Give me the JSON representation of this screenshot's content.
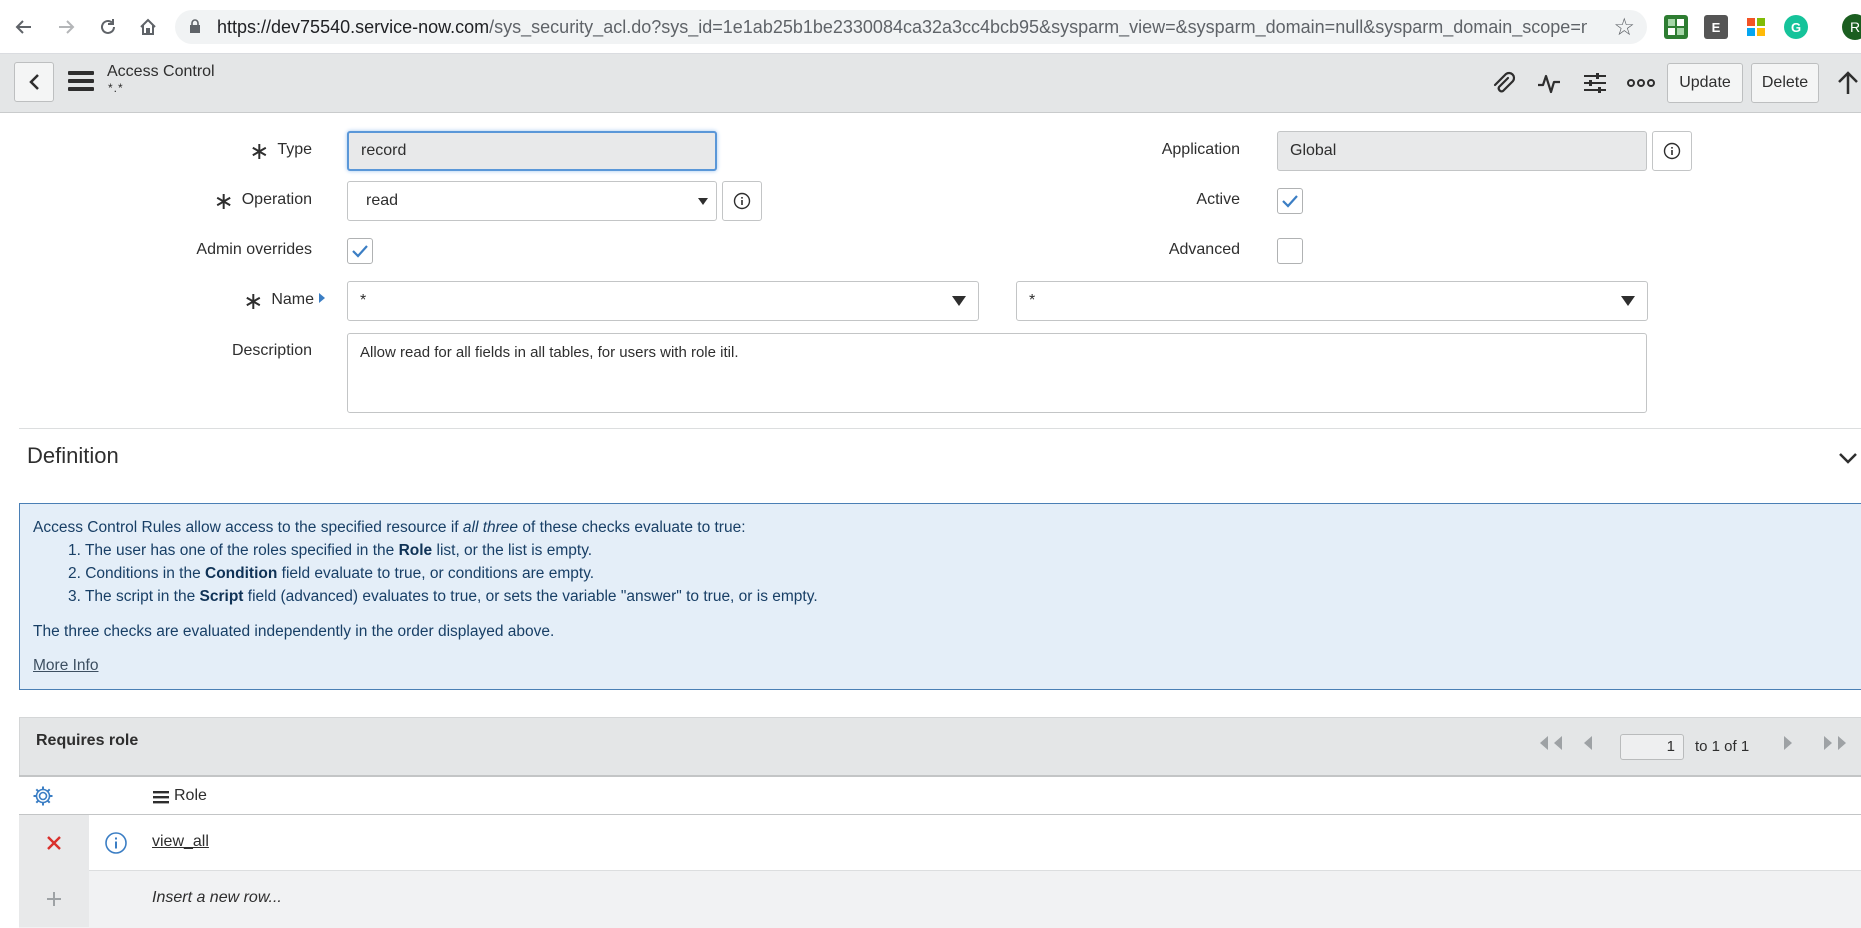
{
  "browser": {
    "url_main": "https://dev75540.service-now.com",
    "url_rest": "/sys_security_acl.do?sys_id=1e1ab25b1be2330084ca32a3cc4bcb95&sysparm_view=&sysparm_domain=null&sysparm_domain_scope=null&sys...",
    "extension_e": "E",
    "extension_g": "G",
    "profile_initial": "R"
  },
  "header": {
    "title": "Access Control",
    "subtitle": "*.*",
    "update_label": "Update",
    "delete_label": "Delete"
  },
  "form": {
    "type_label": "Type",
    "type_value": "record",
    "operation_label": "Operation",
    "operation_value": "read",
    "admin_overrides_label": "Admin overrides",
    "admin_overrides_checked": true,
    "name_label": "Name",
    "name_table_value": "*",
    "name_field_value": "*",
    "description_label": "Description",
    "description_value": "Allow read for all fields in all tables, for users with role itil.",
    "application_label": "Application",
    "application_value": "Global",
    "active_label": "Active",
    "active_checked": true,
    "advanced_label": "Advanced",
    "advanced_checked": false
  },
  "definition": {
    "title": "Definition",
    "intro_a": "Access Control Rules allow access to the specified resource if ",
    "intro_em": "all three",
    "intro_b": " of these checks evaluate to true:",
    "item1_a": "1. The user has one of the roles specified in the ",
    "item1_b": "Role",
    "item1_c": " list, or the list is empty.",
    "item2_a": "2. Conditions in the ",
    "item2_b": "Condition",
    "item2_c": " field evaluate to true, or conditions are empty.",
    "item3_a": "3. The script in the ",
    "item3_b": "Script",
    "item3_c": " field (advanced) evaluates to true, or sets the variable \"answer\" to true, or is empty.",
    "footer": "The three checks are evaluated independently in the order displayed above.",
    "more_info": "More Info"
  },
  "related_list": {
    "title": "Requires role",
    "page_value": "1",
    "page_of": "to 1 of 1",
    "column_role": "Role",
    "rows": [
      {
        "role": "view_all"
      }
    ],
    "insert_placeholder": "Insert a new row..."
  },
  "colors": {
    "accent": "#5a97d8",
    "info_panel_bg": "#e4eef8",
    "info_panel_border": "#4a7fb5",
    "delete_red": "#d9302c",
    "check_blue": "#3b7ec4"
  }
}
